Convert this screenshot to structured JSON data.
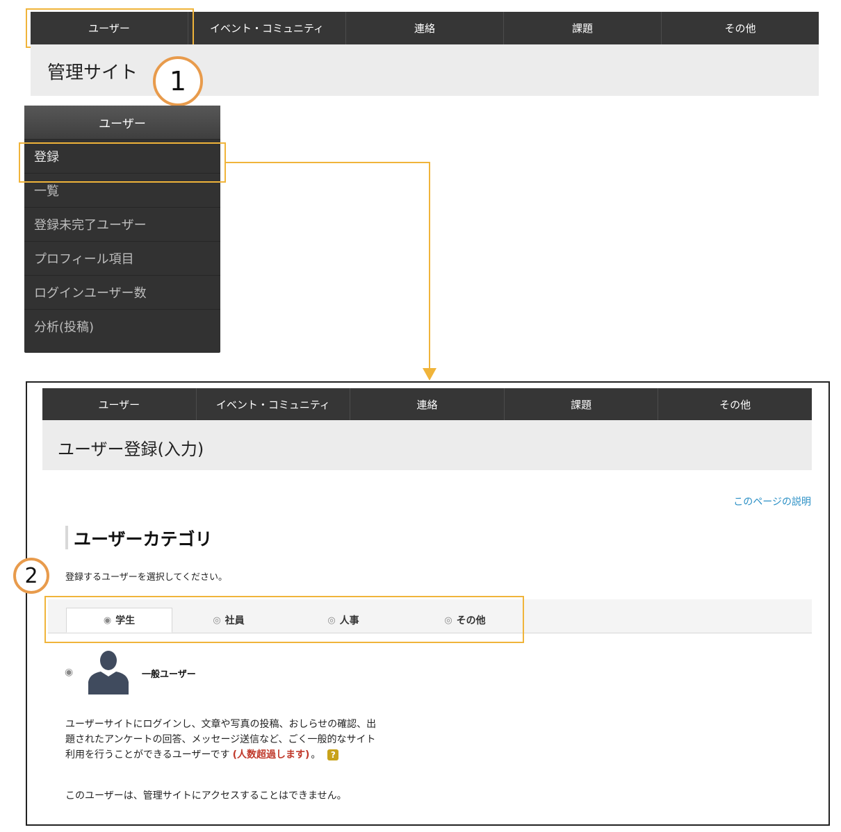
{
  "top_nav": {
    "items": [
      "ユーザー",
      "イベント・コミュニティ",
      "連絡",
      "課題",
      "その他"
    ]
  },
  "top_title": "管理サイト",
  "markers": {
    "one": "1",
    "two": "2"
  },
  "sidebar": {
    "header": "ユーザー",
    "items": [
      "登録",
      "一覧",
      "登録未完了ユーザー",
      "プロフィール項目",
      "ログインユーザー数",
      "分析(投稿)"
    ]
  },
  "detail": {
    "nav_items": [
      "ユーザー",
      "イベント・コミュニティ",
      "連絡",
      "課題",
      "その他"
    ],
    "page_title": "ユーザー登録(入力)",
    "help_link": "このページの説明",
    "section_heading": "ユーザーカテゴリ",
    "instruction": "登録するユーザーを選択してください。",
    "tabs": [
      "学生",
      "社員",
      "人事",
      "その他"
    ],
    "selected_tab": "学生",
    "user_type_label": "一般ユーザー",
    "desc_line1": "ユーザーサイトにログインし、文章や写真の投稿、おしらせの確認、出",
    "desc_line2": "題されたアンケートの回答、メッセージ送信など、ごく一般的なサイト",
    "desc_line3_prefix": "利用を行うことができるユーザーです",
    "desc_warning": "(人数超過します)",
    "desc_line3_suffix": "。",
    "help_badge": "?",
    "access_note": "このユーザーは、管理サイトにアクセスすることはできません。"
  },
  "colors": {
    "nav_bg": "#363636",
    "highlight": "#f0b43a",
    "marker_ring": "#e89b4c",
    "link": "#2a8fc5",
    "warning": "#c0392b",
    "badge": "#c8a21a",
    "avatar": "#404b5e"
  },
  "icons": {
    "help": "question-badge-icon",
    "user": "user-silhouette-icon",
    "arrow": "arrow-down-icon"
  }
}
